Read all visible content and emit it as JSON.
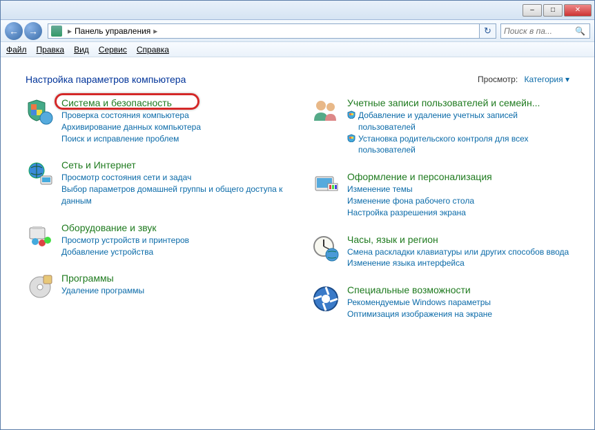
{
  "titlebar": {
    "min": "–",
    "max": "□",
    "close": "✕"
  },
  "nav": {
    "back": "←",
    "fwd": "→",
    "breadcrumb": "Панель управления",
    "sep": "▸",
    "refresh": "↻",
    "search_placeholder": "Поиск в па..."
  },
  "menu": {
    "file": "Файл",
    "edit": "Правка",
    "view": "Вид",
    "tools": "Сервис",
    "help": "Справка"
  },
  "heading": "Настройка параметров компьютера",
  "view_label": "Просмотр:",
  "view_mode": "Категория ▾",
  "cats": {
    "system": {
      "title": "Система и безопасность",
      "links": [
        "Проверка состояния компьютера",
        "Архивирование данных компьютера",
        "Поиск и исправление проблем"
      ]
    },
    "network": {
      "title": "Сеть и Интернет",
      "links": [
        "Просмотр состояния сети и задач",
        "Выбор параметров домашней группы и общего доступа к данным"
      ]
    },
    "hardware": {
      "title": "Оборудование и звук",
      "links": [
        "Просмотр устройств и принтеров",
        "Добавление устройства"
      ]
    },
    "programs": {
      "title": "Программы",
      "links": [
        "Удаление программы"
      ]
    },
    "users": {
      "title": "Учетные записи пользователей и семейн...",
      "links": [
        "Добавление и удаление учетных записей пользователей",
        "Установка родительского контроля для всех пользователей"
      ]
    },
    "appearance": {
      "title": "Оформление и персонализация",
      "links": [
        "Изменение темы",
        "Изменение фона рабочего стола",
        "Настройка разрешения экрана"
      ]
    },
    "clock": {
      "title": "Часы, язык и регион",
      "links": [
        "Смена раскладки клавиатуры или других способов ввода",
        "Изменение языка интерфейса"
      ]
    },
    "ease": {
      "title": "Специальные возможности",
      "links": [
        "Рекомендуемые Windows параметры",
        "Оптимизация изображения на экране"
      ]
    }
  }
}
